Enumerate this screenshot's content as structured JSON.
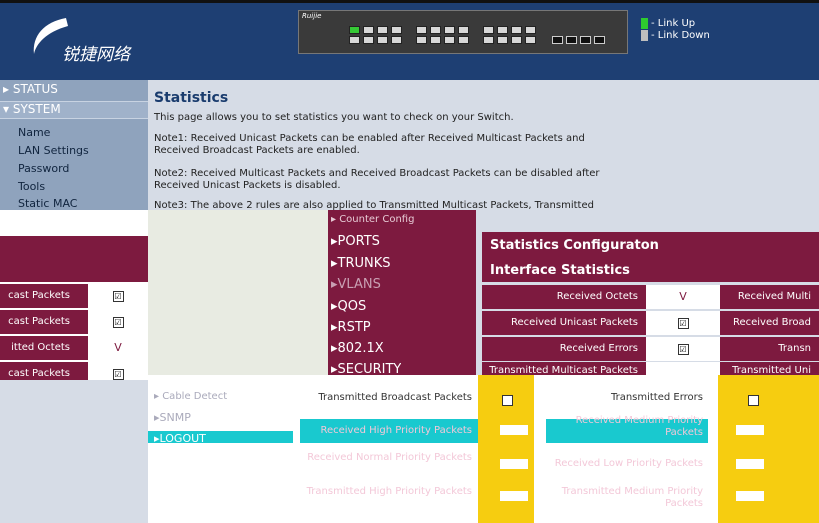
{
  "header": {
    "logo_text": "锐捷网络",
    "switch_brand": "Ruijie",
    "legend": {
      "link_up": "- Link Up",
      "link_down": "- Link Down",
      "up_color": "#2ecc2e",
      "down_color": "#bfbfbf"
    }
  },
  "sidebar": {
    "status": "STATUS",
    "system": "SYSTEM",
    "items": [
      "Name",
      "LAN Settings",
      "Password",
      "Tools",
      "Static MAC"
    ]
  },
  "main": {
    "title": "Statistics",
    "intro": "This page allows you to set statistics you want to check on your Switch.",
    "note1": "Note1: Received Unicast Packets can be enabled after Received Multicast Packets and Received Broadcast Packets are enabled.",
    "note2": "Note2: Received Multicast Packets and Received Broadcast Packets can be disabled after Received Unicast Packets is disabled.",
    "note3": "Note3: The above 2 rules are also applied to Transmitted Multicast Packets, Transmitted Unicast"
  },
  "left_panel": {
    "rows": [
      {
        "label": "cast Packets",
        "value": "☑"
      },
      {
        "label": "cast Packets",
        "value": "☑"
      },
      {
        "label": "itted Octets",
        "value": "V"
      },
      {
        "label": "cast Packets",
        "value": "☑"
      }
    ]
  },
  "menu2": {
    "items": [
      "Counter Config",
      "PORTS",
      "TRUNKS",
      "VLANS",
      "QOS",
      "RSTP",
      "802.1X",
      "SECURITY"
    ],
    "bottom_items": [
      "Cable Detect",
      "SNMP",
      "LOGOUT"
    ]
  },
  "right_panel": {
    "heading1": "Statistics Configuraton",
    "heading2": "Interface Statistics",
    "rows": [
      {
        "label": "Received Octets",
        "value": "V",
        "label2": "Received Multi"
      },
      {
        "label": "Received Unicast Packets",
        "value": "☑",
        "label2": "Received Broad"
      },
      {
        "label": "Received Errors",
        "value": "☑",
        "label2": "Transn"
      },
      {
        "label": "Transmitted Multicast Packets",
        "value": "☑",
        "label2": "Transmitted Uni"
      }
    ]
  },
  "bottom": {
    "rows": [
      {
        "left": "Transmitted Broadcast Packets",
        "right": "Transmitted Errors"
      },
      {
        "left": "Received High Priority Packets",
        "right": "Received Medium Priority Packets"
      },
      {
        "left": "Received Normal Priority Packets",
        "right": "Received Low Priority Packets"
      },
      {
        "left": "Transmitted High Priority Packets",
        "right": "Transmitted Medium Priority Packets"
      }
    ]
  }
}
